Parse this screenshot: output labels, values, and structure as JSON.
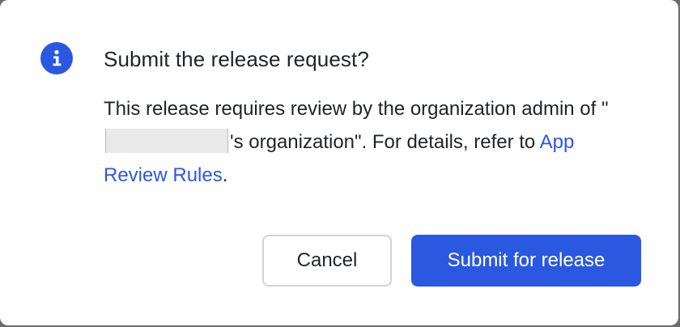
{
  "dialog": {
    "title": "Submit the release request?",
    "body_part1": "This release requires review by the organization admin of \"",
    "body_part2": "'s organization\". For details, refer to ",
    "link_text": "App Review Rules",
    "body_end": ".",
    "icon": "info-icon",
    "cancel_label": "Cancel",
    "submit_label": "Submit for release"
  },
  "colors": {
    "accent": "#2b58e0",
    "text": "#1f2329",
    "border": "#d0d3d6"
  }
}
